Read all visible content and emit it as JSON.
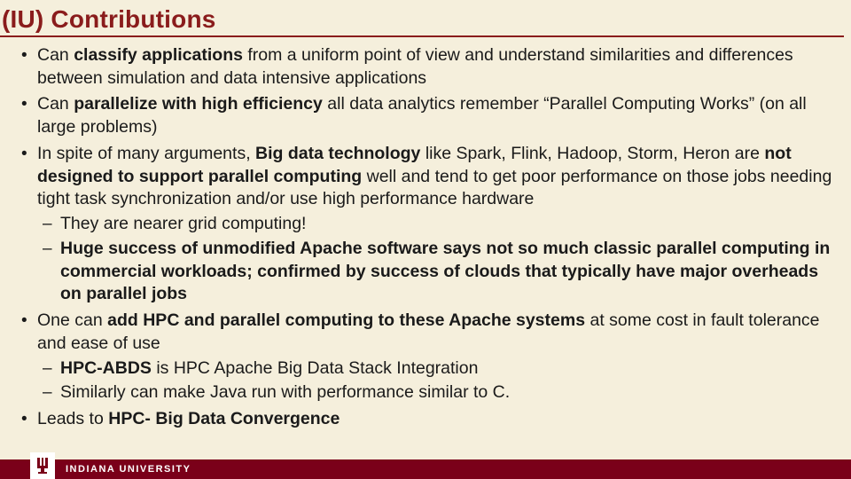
{
  "title": "(IU) Contributions",
  "bullets": [
    {
      "runs": [
        {
          "t": "Can ",
          "b": false
        },
        {
          "t": "classify applications ",
          "b": true
        },
        {
          "t": "from a uniform point of view and understand similarities and differences between simulation and data intensive applications",
          "b": false
        }
      ]
    },
    {
      "runs": [
        {
          "t": "Can ",
          "b": false
        },
        {
          "t": "parallelize with high efficiency ",
          "b": true
        },
        {
          "t": "all data analytics remember “Parallel Computing Works” (on all large problems)",
          "b": false
        }
      ]
    },
    {
      "runs": [
        {
          "t": "In spite of many arguments, ",
          "b": false
        },
        {
          "t": "Big data technology ",
          "b": true
        },
        {
          "t": "like Spark, Flink, Hadoop, Storm, Heron are ",
          "b": false
        },
        {
          "t": "not designed to support parallel computing ",
          "b": true
        },
        {
          "t": "well and tend to get poor performance on those jobs needing tight task synchronization and/or use high performance hardware",
          "b": false
        }
      ],
      "sub": [
        {
          "runs": [
            {
              "t": "They are nearer grid computing!",
              "b": false
            }
          ]
        },
        {
          "runs": [
            {
              "t": "Huge success of unmodified Apache software says not so much classic parallel computing in commercial workloads; confirmed by success of clouds that typically have major overheads on parallel jobs",
              "b": true
            }
          ]
        }
      ]
    },
    {
      "runs": [
        {
          "t": "One can ",
          "b": false
        },
        {
          "t": "add HPC and parallel computing to these Apache systems ",
          "b": true
        },
        {
          "t": "at some cost in fault tolerance and ease of use",
          "b": false
        }
      ],
      "sub": [
        {
          "runs": [
            {
              "t": "HPC-ABDS ",
              "b": true
            },
            {
              "t": "is HPC Apache Big Data Stack Integration",
              "b": false
            }
          ]
        },
        {
          "runs": [
            {
              "t": "Similarly can make Java run with performance similar to C.",
              "b": false
            }
          ]
        }
      ]
    },
    {
      "runs": [
        {
          "t": "Leads  to ",
          "b": false
        },
        {
          "t": "HPC- Big Data Convergence",
          "b": true
        }
      ]
    }
  ],
  "footer": {
    "org": "INDIANA UNIVERSITY",
    "logo_alt": "IU trident logo"
  },
  "colors": {
    "background": "#f5efdc",
    "heading": "#8a1c1c",
    "brand": "#7a0019"
  }
}
